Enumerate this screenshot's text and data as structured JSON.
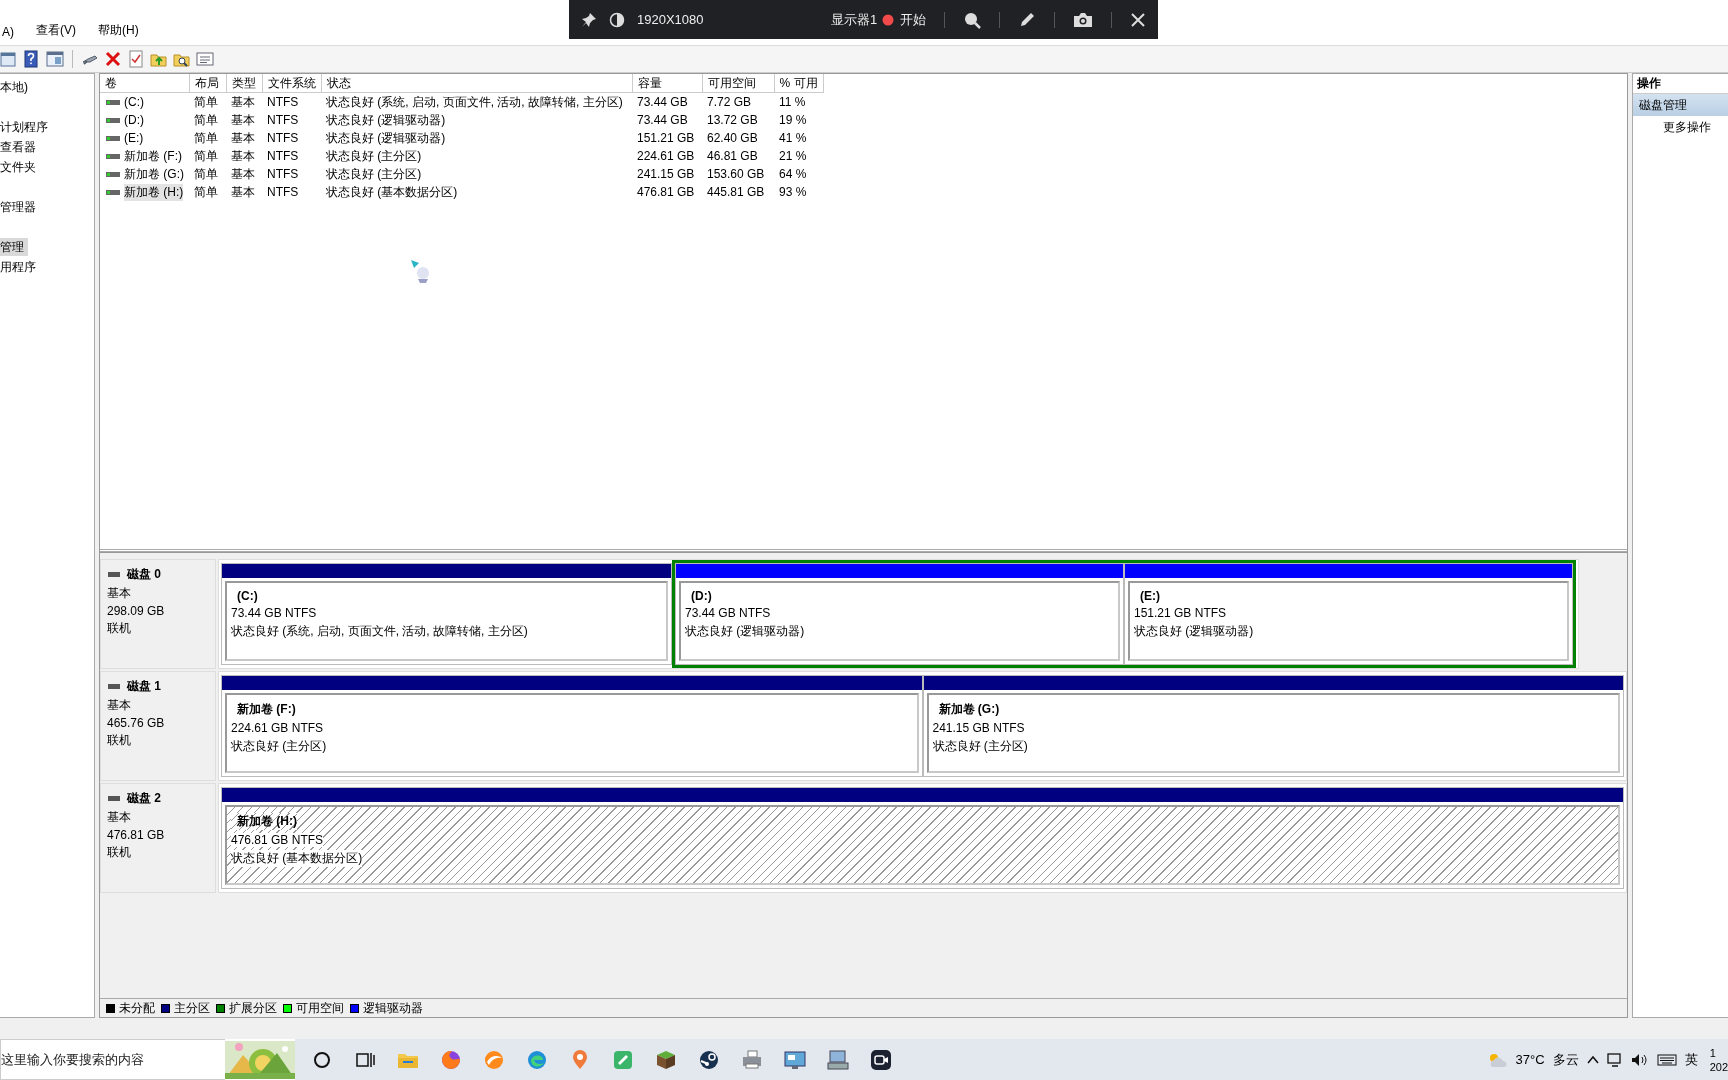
{
  "menu": [
    "A)",
    "查看(V)",
    "帮助(H)"
  ],
  "recorder": {
    "resolution": "1920X1080",
    "display": "显示器1",
    "record": "开始"
  },
  "tree": [
    {
      "label": "本地)",
      "selected": false
    },
    {
      "label": "计划程序",
      "selected": false
    },
    {
      "label": "查看器",
      "selected": false
    },
    {
      "label": "文件夹",
      "selected": false
    },
    {
      "label": "管理器",
      "selected": false
    },
    {
      "label": "管理",
      "selected": true
    },
    {
      "label": "用程序",
      "selected": false
    }
  ],
  "volumes": {
    "columns": [
      "卷",
      "布局",
      "类型",
      "文件系统",
      "状态",
      "容量",
      "可用空间",
      "% 可用"
    ],
    "rows": [
      {
        "volume": "(C:)",
        "layout": "简单",
        "type": "基本",
        "fs": "NTFS",
        "status": "状态良好 (系统, 启动, 页面文件, 活动, 故障转储, 主分区)",
        "capacity": "73.44 GB",
        "free": "7.72 GB",
        "pct": "11 %",
        "selected": false
      },
      {
        "volume": "(D:)",
        "layout": "简单",
        "type": "基本",
        "fs": "NTFS",
        "status": "状态良好 (逻辑驱动器)",
        "capacity": "73.44 GB",
        "free": "13.72 GB",
        "pct": "19 %",
        "selected": false
      },
      {
        "volume": "(E:)",
        "layout": "简单",
        "type": "基本",
        "fs": "NTFS",
        "status": "状态良好 (逻辑驱动器)",
        "capacity": "151.21 GB",
        "free": "62.40 GB",
        "pct": "41 %",
        "selected": false
      },
      {
        "volume": "新加卷 (F:)",
        "layout": "简单",
        "type": "基本",
        "fs": "NTFS",
        "status": "状态良好 (主分区)",
        "capacity": "224.61 GB",
        "free": "46.81 GB",
        "pct": "21 %",
        "selected": false
      },
      {
        "volume": "新加卷 (G:)",
        "layout": "简单",
        "type": "基本",
        "fs": "NTFS",
        "status": "状态良好 (主分区)",
        "capacity": "241.15 GB",
        "free": "153.60 GB",
        "pct": "64 %",
        "selected": false
      },
      {
        "volume": "新加卷 (H:)",
        "layout": "简单",
        "type": "基本",
        "fs": "NTFS",
        "status": "状态良好 (基本数据分区)",
        "capacity": "476.81 GB",
        "free": "445.81 GB",
        "pct": "93 %",
        "selected": true
      }
    ]
  },
  "disks": [
    {
      "name": "磁盘 0",
      "type": "基本",
      "size": "298.09 GB",
      "state": "联机",
      "partitions": [
        {
          "kind": "primary",
          "label": "(C:)",
          "size": "73.44 GB NTFS",
          "status": "状态良好 (系统, 启动, 页面文件, 活动, 故障转储, 主分区)",
          "selected": false
        },
        {
          "kind": "extended",
          "children": [
            {
              "kind": "logical",
              "label": "(D:)",
              "size": "73.44 GB NTFS",
              "status": "状态良好 (逻辑驱动器)",
              "selected": false
            },
            {
              "kind": "logical",
              "label": "(E:)",
              "size": "151.21 GB NTFS",
              "status": "状态良好 (逻辑驱动器)",
              "selected": false
            }
          ]
        }
      ]
    },
    {
      "name": "磁盘 1",
      "type": "基本",
      "size": "465.76 GB",
      "state": "联机",
      "partitions": [
        {
          "kind": "primary",
          "label": "新加卷 (F:)",
          "size": "224.61 GB NTFS",
          "status": "状态良好 (主分区)",
          "selected": false
        },
        {
          "kind": "primary",
          "label": "新加卷 (G:)",
          "size": "241.15 GB NTFS",
          "status": "状态良好 (主分区)",
          "selected": false
        }
      ]
    },
    {
      "name": "磁盘 2",
      "type": "基本",
      "size": "476.81 GB",
      "state": "联机",
      "partitions": [
        {
          "kind": "primary",
          "label": "新加卷 (H:)",
          "size": "476.81 GB NTFS",
          "status": "状态良好 (基本数据分区)",
          "selected": true
        }
      ]
    }
  ],
  "legend": [
    {
      "label": "未分配",
      "color": "#000000"
    },
    {
      "label": "主分区",
      "color": "#000080"
    },
    {
      "label": "扩展分区",
      "color": "#008000"
    },
    {
      "label": "可用空间",
      "color": "#00ff00"
    },
    {
      "label": "逻辑驱动器",
      "color": "#0000ff"
    }
  ],
  "actions": {
    "title": "操作",
    "items": [
      {
        "kind": "section",
        "label": "磁盘管理",
        "selected": true
      },
      {
        "kind": "item",
        "label": "更多操作",
        "selected": false
      }
    ]
  },
  "taskbar": {
    "search": {
      "placeholder": "这里输入你要搜索的内容"
    },
    "weather": {
      "temp": "37°C",
      "desc": "多云"
    },
    "ime": "英",
    "clock": [
      "1",
      "202"
    ]
  }
}
